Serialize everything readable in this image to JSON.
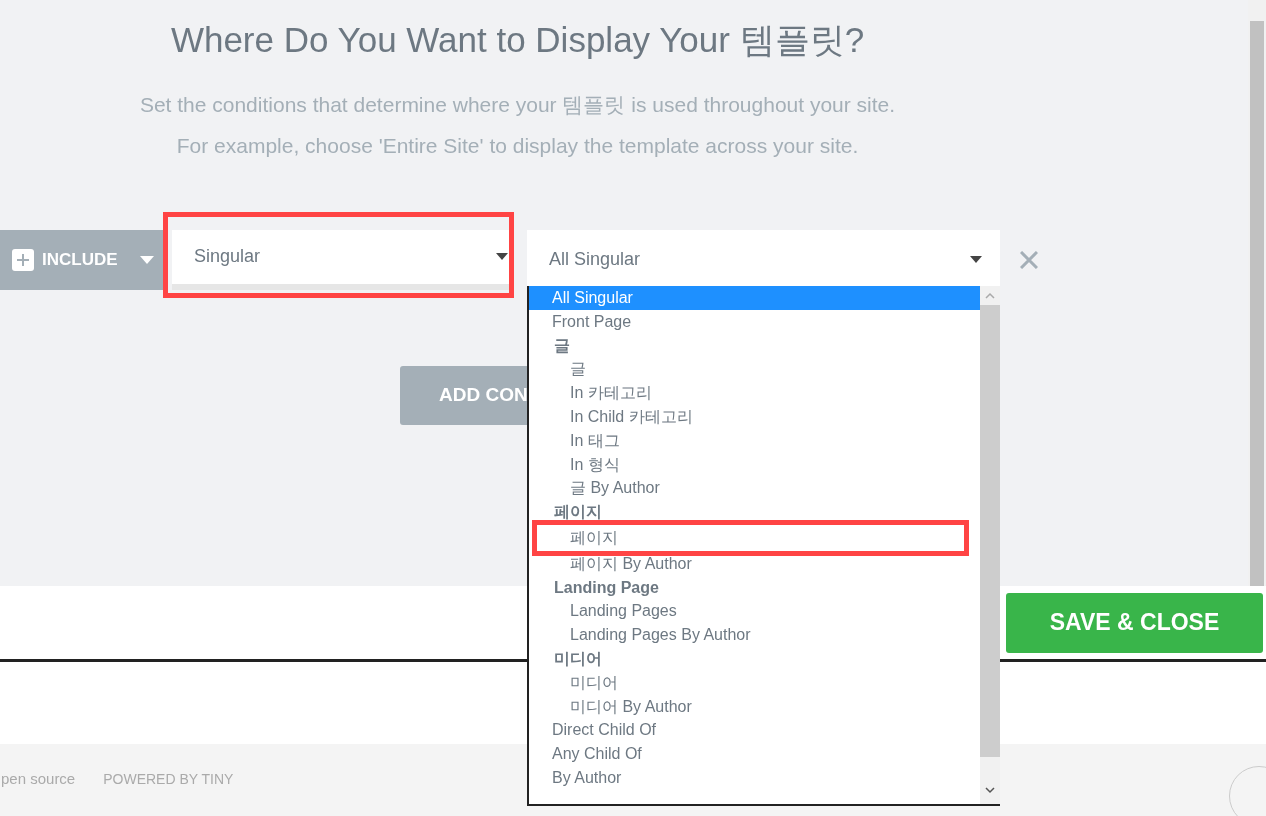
{
  "heading": {
    "title": "Where Do You Want to Display Your 템플릿?",
    "subtitle_lines": [
      "Set the conditions that determine where your 템플릿 is used throughout your site.",
      "For example, choose 'Entire Site' to display the template across your site."
    ]
  },
  "condition": {
    "type_button": "INCLUDE",
    "first_select": "Singular",
    "second_select": "All Singular"
  },
  "add_button": "ADD CON",
  "dropdown_list": [
    {
      "kind": "option",
      "label": "All Singular",
      "selected": true
    },
    {
      "kind": "option",
      "label": "Front Page",
      "selected": false
    },
    {
      "kind": "group",
      "label": "글",
      "children": [
        {
          "label": "글",
          "selected": false
        },
        {
          "label": "In 카테고리",
          "selected": false
        },
        {
          "label": "In Child 카테고리",
          "selected": false
        },
        {
          "label": "In 태그",
          "selected": false
        },
        {
          "label": "In 형식",
          "selected": false
        },
        {
          "label": "글 By Author",
          "selected": false
        }
      ]
    },
    {
      "kind": "group",
      "label": "페이지",
      "children": [
        {
          "label": "페이지",
          "selected": false,
          "highlighted": true
        },
        {
          "label": "페이지 By Author",
          "selected": false
        }
      ]
    },
    {
      "kind": "group",
      "label": "Landing Page",
      "children": [
        {
          "label": "Landing Pages",
          "selected": false
        },
        {
          "label": "Landing Pages By Author",
          "selected": false
        }
      ]
    },
    {
      "kind": "group",
      "label": "미디어",
      "children": [
        {
          "label": "미디어",
          "selected": false
        },
        {
          "label": "미디어 By Author",
          "selected": false
        }
      ]
    },
    {
      "kind": "option",
      "label": "Direct Child Of",
      "selected": false
    },
    {
      "kind": "option",
      "label": "Any Child Of",
      "selected": false
    },
    {
      "kind": "option",
      "label": "By Author",
      "selected": false
    }
  ],
  "save_button": "SAVE & CLOSE",
  "footer": {
    "left_text": "pen source",
    "powered_by": "POWERED BY TINY"
  }
}
